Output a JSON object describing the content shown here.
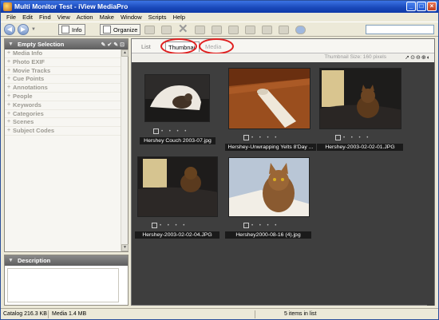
{
  "window": {
    "title": "Multi Monitor Test - iView MediaPro",
    "buttons": {
      "minimize": "_",
      "maximize": "□",
      "close": "×"
    }
  },
  "menu": [
    "File",
    "Edit",
    "Find",
    "View",
    "Action",
    "Make",
    "Window",
    "Scripts",
    "Help"
  ],
  "toolbar": {
    "info_label": "Info",
    "organize_label": "Organize",
    "search_placeholder": ""
  },
  "left_pane": {
    "header": "Empty Selection",
    "categories": [
      "Media Info",
      "Photo EXIF",
      "Movie Tracks",
      "Cue Points",
      "Annotations",
      "People",
      "Keywords",
      "Categories",
      "Scenes",
      "Subject Codes"
    ],
    "description_header": "Description"
  },
  "browser": {
    "tabs": {
      "list": "List",
      "thumbnail": "Thumbnail",
      "media": "Media"
    },
    "thumbnail_size_label": "Thumbnail Size: 160 pixels",
    "meta_dots": "• • • •",
    "thumbnails": [
      {
        "filename": "Hershey Couch 2003-07.jpg",
        "scene": "couch"
      },
      {
        "filename": "Hershey-Unwrapping Yelts 8'Day ...",
        "scene": "floor"
      },
      {
        "filename": "Hershey-2003-02-02-01.JPG",
        "scene": "dark-cat"
      },
      {
        "filename": "Hershey-2003-02-02-04.JPG",
        "scene": "dark-couch"
      },
      {
        "filename": "Hershey2000-08-16 (4).jpg",
        "scene": "portrait"
      }
    ]
  },
  "status": {
    "catalog": "Catalog  216.3 KB",
    "media": "Media  1.4 MB",
    "count": "5 items in list"
  },
  "colors": {
    "title_bar": "#1947b8",
    "highlight_ring": "#e02020",
    "browser_bg": "#3e3e3e"
  }
}
